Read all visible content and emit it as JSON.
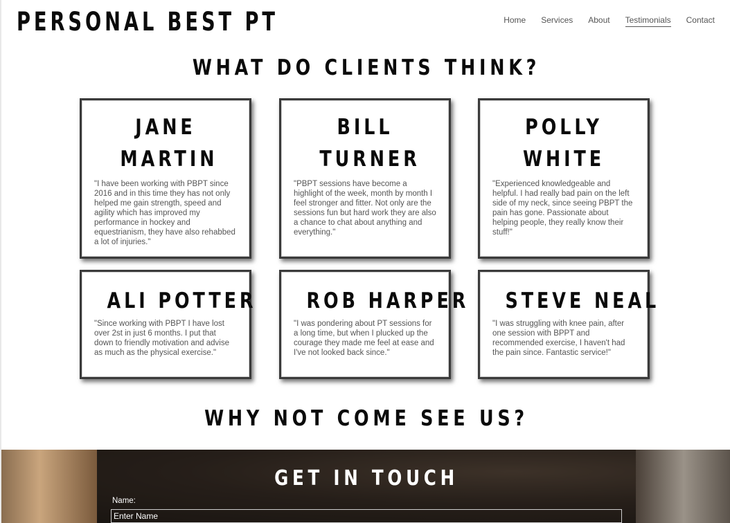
{
  "brand": "PERSONAL BEST PT",
  "nav": {
    "items": [
      "Home",
      "Services",
      "About",
      "Testimonials",
      "Contact"
    ],
    "active": "Testimonials"
  },
  "testimonials": {
    "heading": "WHAT DO CLIENTS THINK?",
    "cards": [
      {
        "name": "JANE MARTIN",
        "quote": "\"I have been working with PBPT since 2016 and in this time they has not only helped me gain strength, speed and agility which has improved my performance in hockey and equestrianism, they have also rehabbed a lot of injuries.\""
      },
      {
        "name": "BILL TURNER",
        "quote": "\"PBPT sessions have become a highlight of the week, month by month I feel stronger and fitter. Not only are the sessions fun but hard work they are also a chance to chat about anything and everything.\""
      },
      {
        "name": "POLLY WHITE",
        "quote": "\"Experienced knowledgeable and helpful. I had really bad pain on the left side of my neck, since seeing PBPT the pain has gone. Passionate about helping people, they really know their stuff!\""
      },
      {
        "name": "ALI POTTER",
        "quote": "\"Since working with PBPT I have lost over 2st in just 6 months. I put that down to friendly motivation and advise as much as the physical exercise.\""
      },
      {
        "name": "ROB HARPER",
        "quote": "\"I was pondering about PT sessions for a long time, but when I plucked up the courage they made me feel at ease and I've not looked back since.\""
      },
      {
        "name": "STEVE NEAL",
        "quote": "\"I was struggling with knee pain, after one session with BPPT and recommended exercise, I haven't had the pain since. Fantastic service!\""
      }
    ]
  },
  "cta_heading": "WHY NOT COME SEE US?",
  "contact": {
    "title": "GET IN TOUCH",
    "name_label": "Name:",
    "name_placeholder": "Enter Name",
    "name_value": ""
  }
}
